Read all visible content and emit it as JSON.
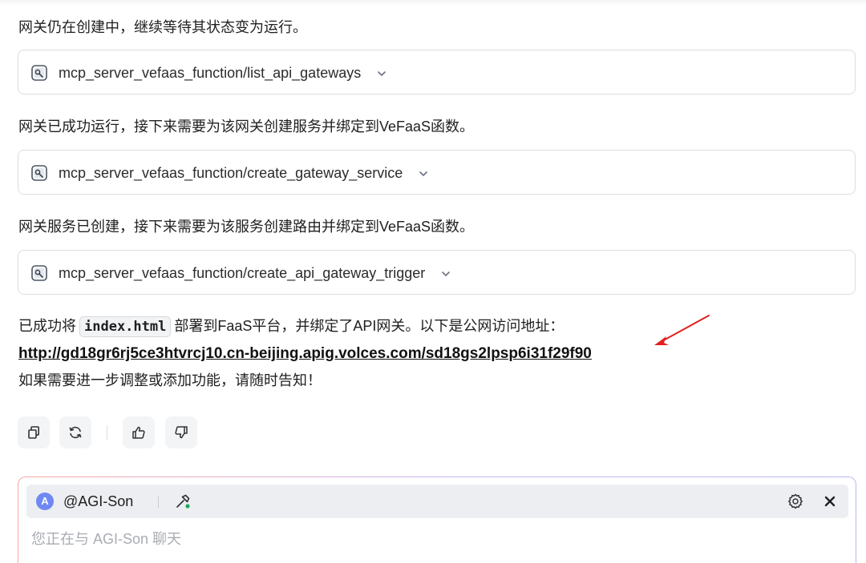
{
  "messages": {
    "status_1": "网关仍在创建中，继续等待其状态变为运行。",
    "status_2": "网关已成功运行，接下来需要为该网关创建服务并绑定到VeFaaS函数。",
    "status_3": "网关服务已创建，接下来需要为该服务创建路由并绑定到VeFaaS函数。",
    "final_prefix": "已成功将",
    "final_code": "index.html",
    "final_suffix": "部署到FaaS平台，并绑定了API网关。以下是公网访问地址：",
    "final_url": "http://gd18gr6rj5ce3htvrcj10.cn-beijing.apig.volces.com/sd18gs2lpsp6i31f29f90",
    "final_closing": "如果需要进一步调整或添加功能，请随时告知！"
  },
  "tool_calls": [
    {
      "name": "mcp_server_vefaas_function/list_api_gateways",
      "icon": "tool-icon"
    },
    {
      "name": "mcp_server_vefaas_function/create_gateway_service",
      "icon": "tool-icon"
    },
    {
      "name": "mcp_server_vefaas_function/create_api_gateway_trigger",
      "icon": "tool-icon"
    }
  ],
  "actions": {
    "copy": "copy-icon",
    "regenerate": "refresh-icon",
    "like": "thumbs-up-icon",
    "dislike": "thumbs-down-icon"
  },
  "composer": {
    "agent_initial": "A",
    "agent_name": "@AGI-Son",
    "placeholder": "您正在与 AGI-Son 聊天",
    "value": ""
  },
  "colors": {
    "annotation_arrow": "#e02020",
    "agent_avatar": "#6f88f3",
    "link_text": "#111111"
  }
}
